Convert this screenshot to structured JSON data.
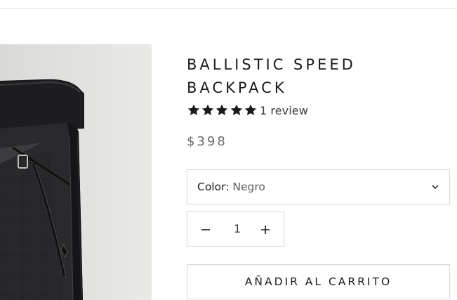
{
  "product": {
    "title": "BALLISTIC SPEED BACKPACK",
    "rating": {
      "stars": 5,
      "label": "1 review"
    },
    "price": "$398",
    "variant": {
      "label": "Color:",
      "value": "Negro"
    },
    "quantity": "1",
    "add_to_cart_label": "AÑADIR AL CARRITO"
  },
  "colors": {
    "text": "#1c1b1b",
    "border": "#d8d8d8",
    "price": "#6a6a6a",
    "image_bg": "#e6e6e4"
  },
  "icons": {
    "star": "star-icon",
    "chevron": "chevron-down-icon",
    "minus": "minus-icon",
    "plus": "plus-icon"
  }
}
